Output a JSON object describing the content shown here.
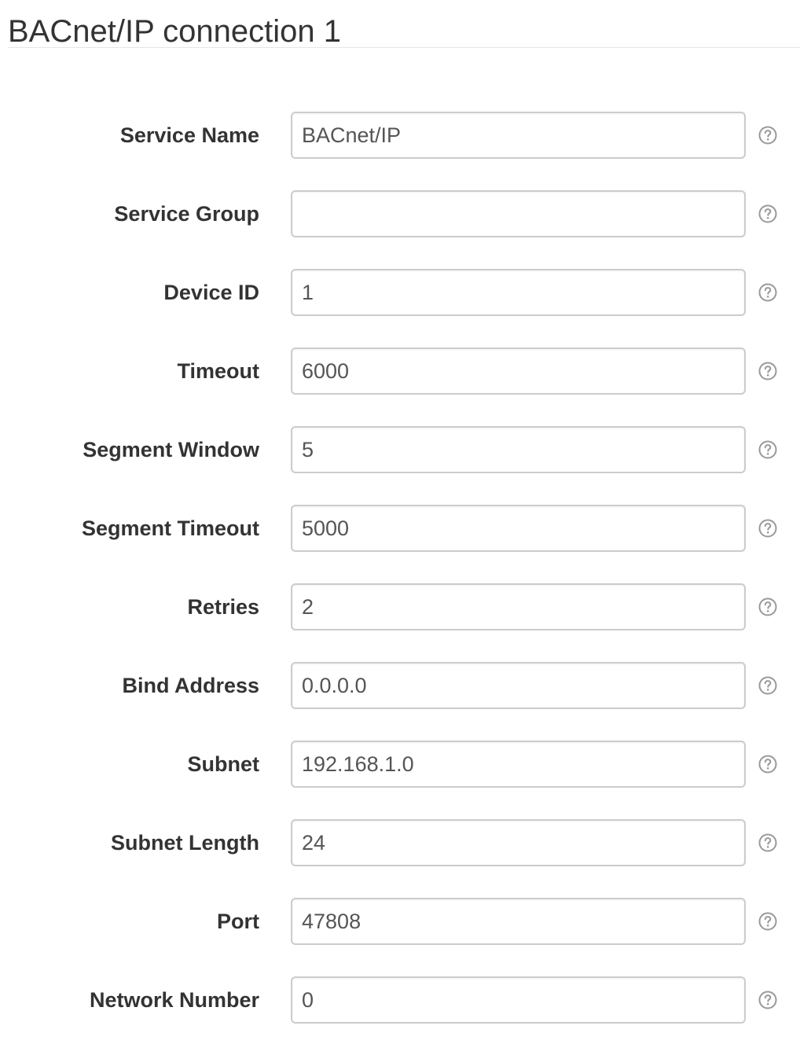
{
  "page": {
    "title": "BACnet/IP connection 1"
  },
  "form": {
    "fields": [
      {
        "label": "Service Name",
        "value": "BACnet/IP",
        "help_icon": "question-circle-icon"
      },
      {
        "label": "Service Group",
        "value": "",
        "help_icon": "question-circle-icon"
      },
      {
        "label": "Device ID",
        "value": "1",
        "help_icon": "question-circle-icon"
      },
      {
        "label": "Timeout",
        "value": "6000",
        "help_icon": "question-circle-icon"
      },
      {
        "label": "Segment Window",
        "value": "5",
        "help_icon": "question-circle-icon"
      },
      {
        "label": "Segment Timeout",
        "value": "5000",
        "help_icon": "question-circle-icon"
      },
      {
        "label": "Retries",
        "value": "2",
        "help_icon": "question-circle-icon"
      },
      {
        "label": "Bind Address",
        "value": "0.0.0.0",
        "help_icon": "question-circle-icon"
      },
      {
        "label": "Subnet",
        "value": "192.168.1.0",
        "help_icon": "question-circle-icon"
      },
      {
        "label": "Subnet Length",
        "value": "24",
        "help_icon": "question-circle-icon"
      },
      {
        "label": "Port",
        "value": "47808",
        "help_icon": "question-circle-icon"
      },
      {
        "label": "Network Number",
        "value": "0",
        "help_icon": "question-circle-icon"
      }
    ]
  },
  "colors": {
    "text": "#333333",
    "input_text": "#555555",
    "input_border": "#cccccc",
    "help_icon": "#999999",
    "rule": "#e5e5e5"
  }
}
